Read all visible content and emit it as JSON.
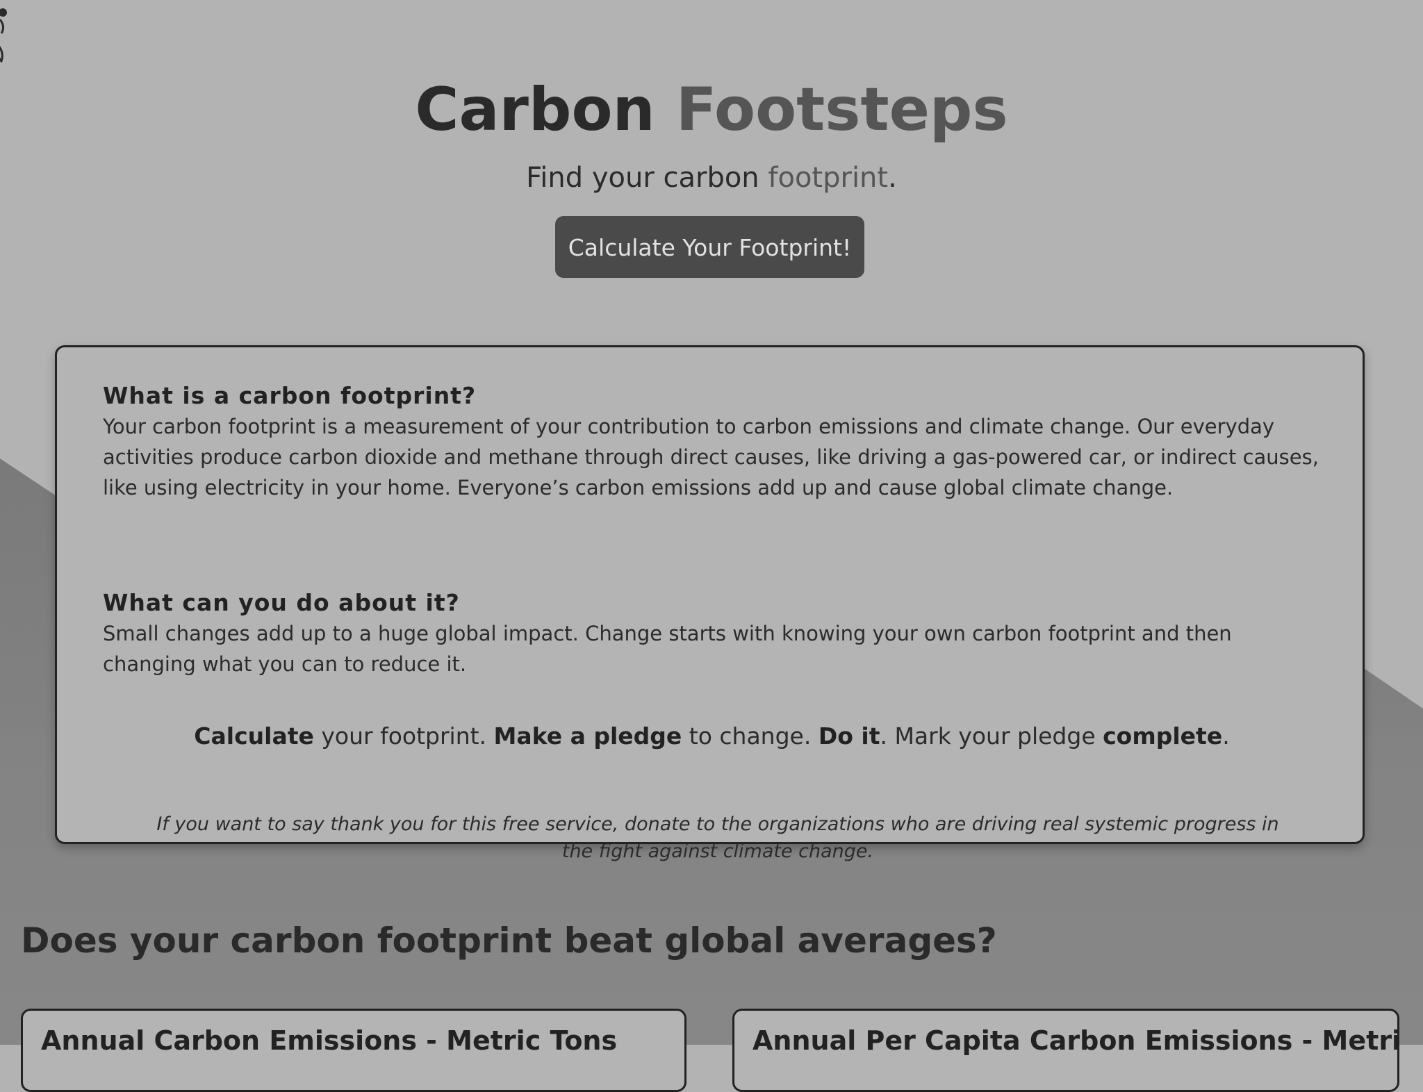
{
  "hero": {
    "title_main": "Carbon",
    "title_accent": "Footsteps",
    "subtitle_main": "Find your carbon",
    "subtitle_accent": "footprint",
    "subtitle_end": ".",
    "cta_label": "Calculate Your Footprint!"
  },
  "info": {
    "q1_heading": "What is a carbon footprint?",
    "q1_body": "Your carbon footprint is a measurement of your contribution to carbon emissions and climate change. Our everyday activities produce carbon dioxide and methane through direct causes, like driving a gas-powered car, or indirect causes, like using electricity in your home. Everyone’s carbon emissions add up and cause global climate change.",
    "q2_heading": "What can you do about it?",
    "q2_body": "Small changes add up to a huge global impact. Change starts with knowing your own carbon footprint and then changing what you can to reduce it.",
    "steps": {
      "s1_bold": "Calculate",
      "s1_rest": " your footprint. ",
      "s2_bold": "Make a pledge",
      "s2_rest": " to change. ",
      "s3_bold": "Do it",
      "s3_rest": ". Mark your pledge ",
      "s4_bold": "complete",
      "s4_rest": "."
    },
    "donate_text": "If you want to say thank you for this free service, donate to the organizations who are driving real systemic progress in the fight against climate change."
  },
  "averages": {
    "heading": "Does your carbon footprint beat global averages?",
    "card1_title": "Annual Carbon Emissions - Metric Tons",
    "card2_title": "Annual Per Capita Carbon Emissions - Metric Tons"
  },
  "colors": {
    "background": "#b3b3b3",
    "button": "#4a4a4a",
    "accent_text": "#555555"
  },
  "icons": {
    "logo": "footsteps-logo-icon"
  }
}
